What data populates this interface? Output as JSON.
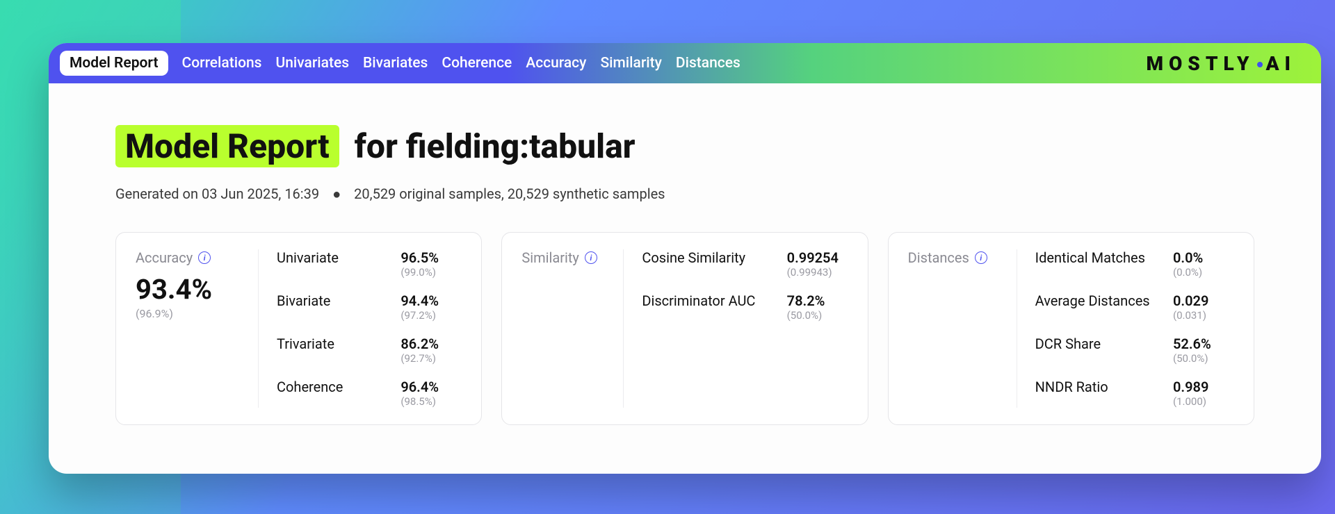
{
  "brand": {
    "name": "MOSTLY AI"
  },
  "tabs": {
    "active": "Model Report",
    "items": [
      "Model Report",
      "Correlations",
      "Univariates",
      "Bivariates",
      "Coherence",
      "Accuracy",
      "Similarity",
      "Distances"
    ]
  },
  "title": {
    "highlight": "Model Report",
    "rest": "for fielding:tabular"
  },
  "meta": {
    "generated_prefix": "Generated on",
    "generated": "03 Jun 2025, 16:39",
    "samples": "20,529 original samples, 20,529 synthetic samples"
  },
  "cards": {
    "accuracy": {
      "title": "Accuracy",
      "overall": "93.4%",
      "overall_sub": "(96.9%)",
      "rows": [
        {
          "label": "Univariate",
          "value": "96.5%",
          "sub": "(99.0%)"
        },
        {
          "label": "Bivariate",
          "value": "94.4%",
          "sub": "(97.2%)"
        },
        {
          "label": "Trivariate",
          "value": "86.2%",
          "sub": "(92.7%)"
        },
        {
          "label": "Coherence",
          "value": "96.4%",
          "sub": "(98.5%)"
        }
      ]
    },
    "similarity": {
      "title": "Similarity",
      "rows": [
        {
          "label": "Cosine Similarity",
          "value": "0.99254",
          "sub": "(0.99943)"
        },
        {
          "label": "Discriminator AUC",
          "value": "78.2%",
          "sub": "(50.0%)"
        }
      ]
    },
    "distances": {
      "title": "Distances",
      "rows": [
        {
          "label": "Identical Matches",
          "value": "0.0%",
          "sub": "(0.0%)"
        },
        {
          "label": "Average Distances",
          "value": "0.029",
          "sub": "(0.031)"
        },
        {
          "label": "DCR Share",
          "value": "52.6%",
          "sub": "(50.0%)"
        },
        {
          "label": "NNDR Ratio",
          "value": "0.989",
          "sub": "(1.000)"
        }
      ]
    }
  }
}
